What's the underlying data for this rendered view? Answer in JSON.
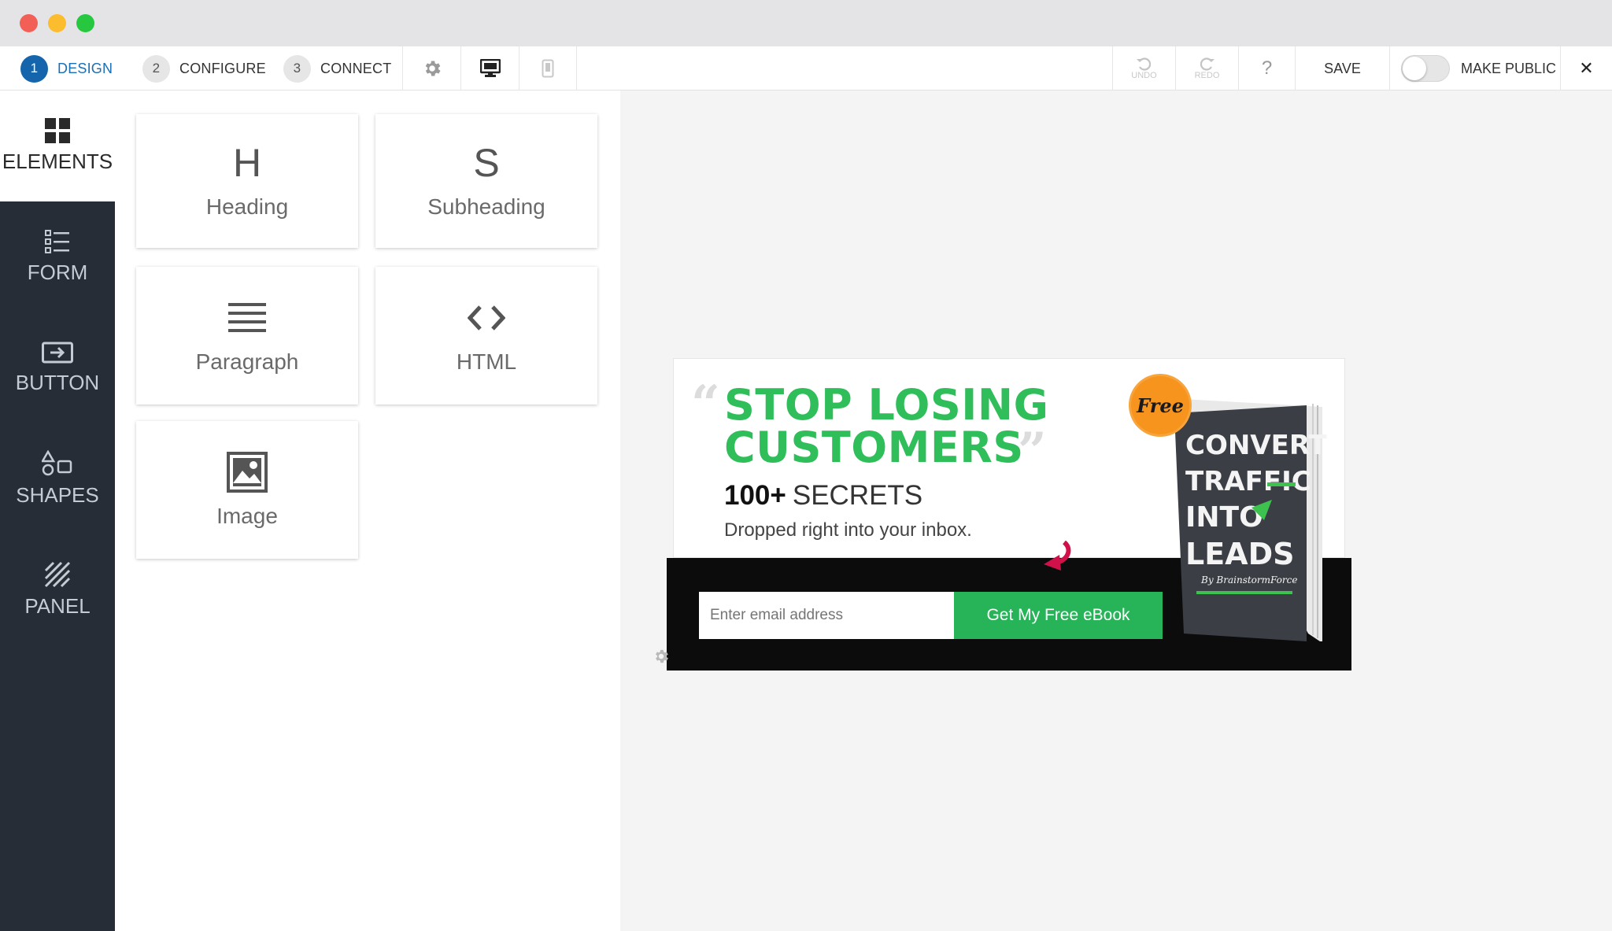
{
  "window": {
    "lights": {
      "close": "#f25f57",
      "minimize": "#fbbc2e",
      "zoom": "#27c840"
    }
  },
  "toolbar": {
    "steps": [
      {
        "num": "1",
        "label": "DESIGN"
      },
      {
        "num": "2",
        "label": "CONFIGURE"
      },
      {
        "num": "3",
        "label": "CONNECT"
      }
    ],
    "icons": [
      "gear-icon",
      "desktop-icon",
      "mobile-icon"
    ],
    "undo_label": "UNDO",
    "redo_label": "REDO",
    "help_label": "?",
    "save_label": "SAVE",
    "make_public_label": "MAKE PUBLIC",
    "close_label": "✕"
  },
  "sidebar": {
    "items": [
      {
        "label": "ELEMENTS",
        "icon": "grid-icon"
      },
      {
        "label": "FORM",
        "icon": "form-list-icon"
      },
      {
        "label": "BUTTON",
        "icon": "button-icon"
      },
      {
        "label": "SHAPES",
        "icon": "shapes-icon"
      },
      {
        "label": "PANEL",
        "icon": "panel-hatch-icon"
      }
    ]
  },
  "elements": [
    {
      "glyph": "H",
      "label": "Heading"
    },
    {
      "glyph": "S",
      "label": "Subheading"
    },
    {
      "glyph": "",
      "label": "Paragraph"
    },
    {
      "glyph": "",
      "label": "HTML"
    },
    {
      "glyph": "",
      "label": "Image"
    }
  ],
  "optin": {
    "headline_line1": "STOP LOSING",
    "headline_line2": "CUSTOMERS",
    "sub_bold": "100+",
    "sub_rest": "SECRETS",
    "small": "Dropped right into your inbox.",
    "email_placeholder": "Enter email address",
    "cta_label": "Get My Free eBook",
    "badge_label": "Free",
    "book_lines": [
      "CONVERT",
      "TRAFFIC",
      "INTO",
      "LEADS"
    ],
    "book_author": "By BrainstormForce",
    "accent": "#2fbe5a",
    "cta_color": "#27b358",
    "badge_color": "#f7941d"
  }
}
